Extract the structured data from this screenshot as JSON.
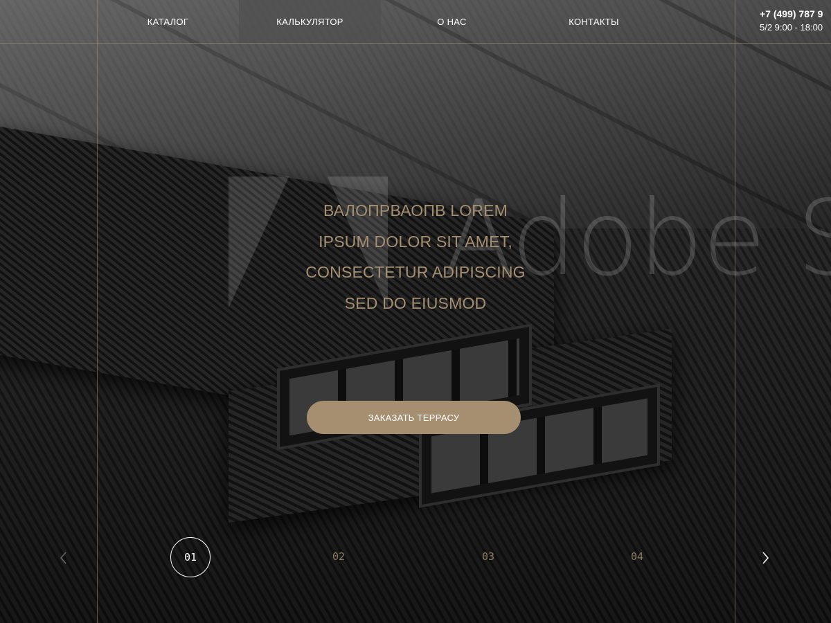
{
  "nav": {
    "items": [
      {
        "label": "КАТАЛОГ",
        "active": false
      },
      {
        "label": "КАЛЬКУЛЯТОР",
        "active": true
      },
      {
        "label": "О НАС",
        "active": false
      },
      {
        "label": "КОНТАКТЫ",
        "active": false
      }
    ]
  },
  "contacts": {
    "phone": "+7 (499) 787 9",
    "hours": "5/2 9:00 - 18:00"
  },
  "hero": {
    "headline_lines": [
      "ВАЛОПРВАОПВ LOREM",
      "IPSUM DOLOR SIT AMET,",
      "CONSECTETUR ADIPISCING",
      "SED DO EIUSMOD"
    ],
    "cta_label": "ЗАКАЗАТЬ ТЕРРАСУ"
  },
  "watermark": {
    "text": "Adobe St"
  },
  "slider": {
    "slides": [
      "01",
      "02",
      "03",
      "04"
    ],
    "active_index": 0
  },
  "colors": {
    "accent": "#a68f70",
    "text_light": "#ffffff",
    "nav_active_bg": "#505050"
  },
  "icons": {
    "prev": "chevron-left-icon",
    "next": "chevron-right-icon"
  }
}
